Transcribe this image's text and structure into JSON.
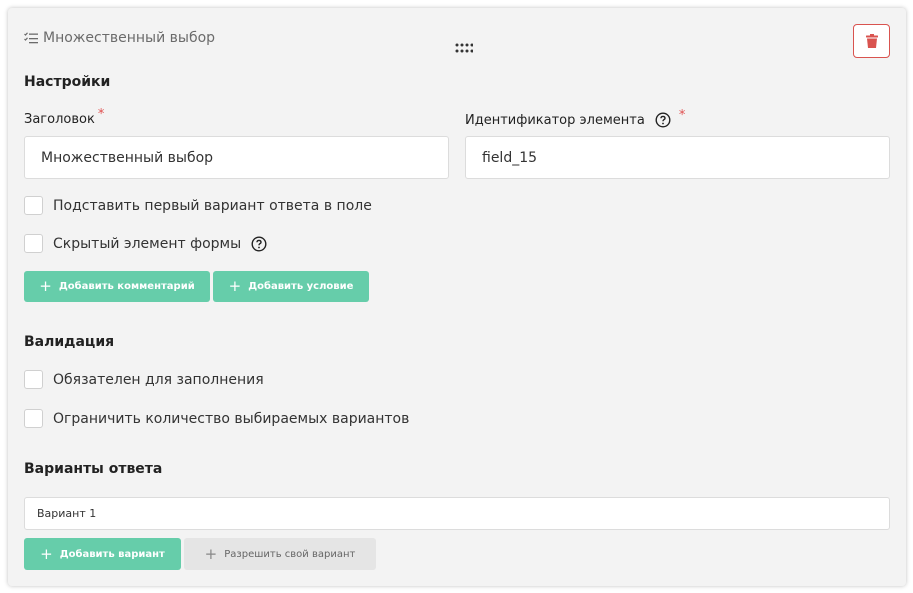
{
  "header": {
    "type_icon": "list-check-icon",
    "type_label": "Множественный выбор",
    "drag_icon": "drag-handle-icon",
    "delete_icon": "trash-icon"
  },
  "settings": {
    "title": "Настройки",
    "heading_label": "Заголовок",
    "heading_value": "Множественный выбор",
    "id_label": "Идентификатор элемента",
    "id_value": "field_15",
    "required_mark": "*",
    "checkbox_first_option": "Подставить первый вариант ответа в поле",
    "checkbox_hidden": "Скрытый элемент формы",
    "add_comment": "Добавить комментарий",
    "add_condition": "Добавить условие"
  },
  "validation": {
    "title": "Валидация",
    "required_field": "Обязателен для заполнения",
    "limit_options": "Ограничить количество выбираемых вариантов"
  },
  "options": {
    "title": "Варианты ответа",
    "items": [
      "Вариант 1"
    ],
    "add_option": "Добавить вариант",
    "allow_custom": "Разрешить свой вариант"
  },
  "colors": {
    "accent": "#66cdaa",
    "danger": "#d9534f",
    "card_bg": "#f3f3f3"
  }
}
